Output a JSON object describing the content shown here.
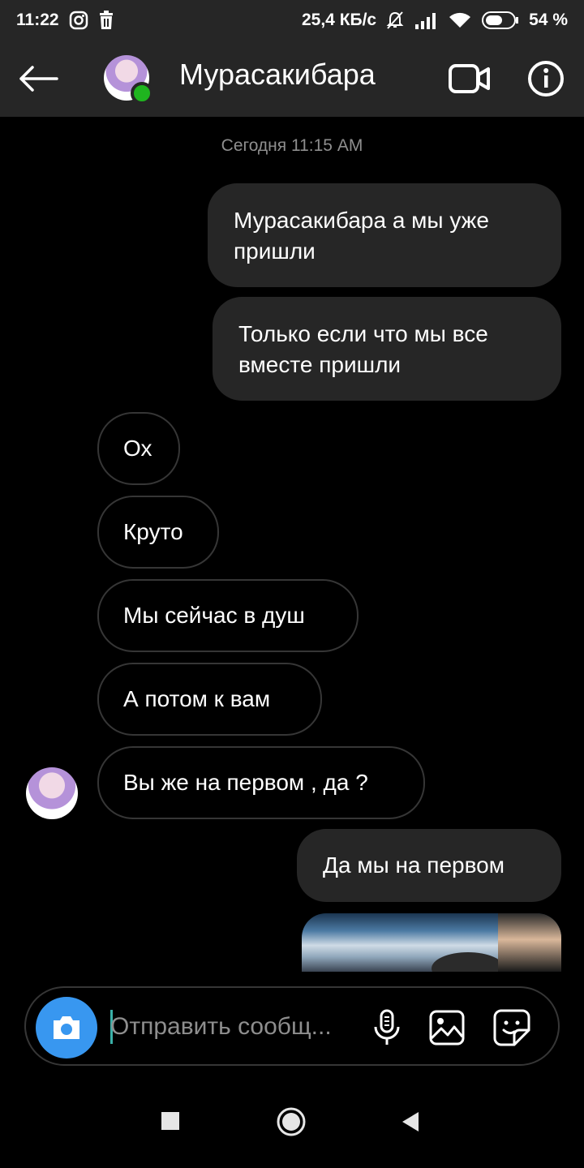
{
  "status_bar": {
    "time": "11:22",
    "net_speed": "25,4 КБ/с",
    "battery": "54 %"
  },
  "header": {
    "title": "Мурасакибара"
  },
  "conversation": {
    "timestamp": "Сегодня 11:15 AM",
    "messages": [
      {
        "direction": "out",
        "text": "Мурасакибара а мы уже пришли"
      },
      {
        "direction": "out",
        "text": "Только если что мы все вместе пришли"
      },
      {
        "direction": "in",
        "text": "Ох"
      },
      {
        "direction": "in",
        "text": "Круто"
      },
      {
        "direction": "in",
        "text": "Мы сейчас в душ"
      },
      {
        "direction": "in",
        "text": "А потом к вам"
      },
      {
        "direction": "in",
        "text": "Вы же на первом , да ?"
      },
      {
        "direction": "out",
        "text": "Да мы на первом"
      }
    ]
  },
  "composer": {
    "placeholder": "Отправить сообщ..."
  },
  "colors": {
    "accent": "#3897f0",
    "online": "#1fb51f",
    "bubble_out": "#262626",
    "bubble_in_border": "#363636"
  }
}
